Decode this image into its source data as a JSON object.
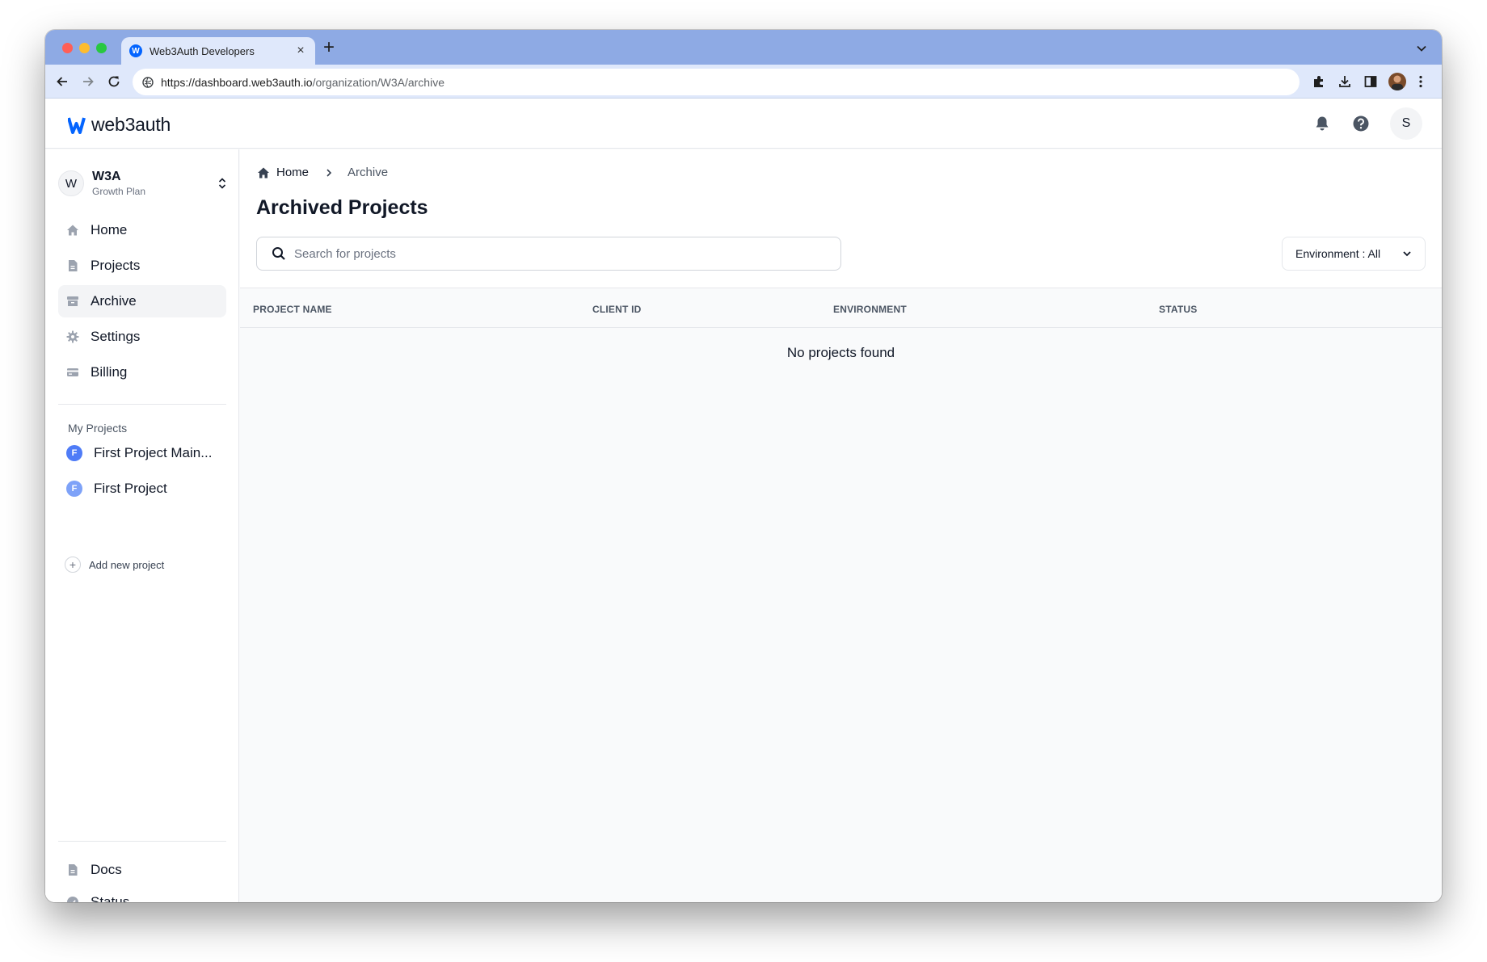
{
  "browser": {
    "tab_title": "Web3Auth Developers",
    "url_host": "https://dashboard.web3auth.io",
    "url_path": "/organization/W3A/archive",
    "tab_favicon_letter": "W"
  },
  "app": {
    "logo_text": "web3auth",
    "brand_color": "#0364ff",
    "user_initial": "S"
  },
  "org": {
    "initial": "W",
    "name": "W3A",
    "plan": "Growth Plan"
  },
  "sidebar": {
    "items": [
      {
        "label": "Home",
        "icon": "home-icon"
      },
      {
        "label": "Projects",
        "icon": "document-icon"
      },
      {
        "label": "Archive",
        "icon": "archive-icon",
        "active": true
      },
      {
        "label": "Settings",
        "icon": "gear-icon"
      },
      {
        "label": "Billing",
        "icon": "credit-card-icon"
      }
    ],
    "projects_title": "My Projects",
    "projects": [
      {
        "badge": "F",
        "label": "First Project Main...",
        "color": "#4f7cf7"
      },
      {
        "badge": "F",
        "label": "First Project",
        "color": "#7ea2f8"
      }
    ],
    "add_project_label": "Add new project",
    "bottom": [
      {
        "label": "Docs",
        "icon": "document-icon"
      },
      {
        "label": "Status",
        "icon": "check-circle-icon"
      }
    ]
  },
  "main": {
    "breadcrumb": {
      "home": "Home",
      "current": "Archive"
    },
    "title": "Archived Projects",
    "search_placeholder": "Search for projects",
    "environment_filter": "Environment : All",
    "columns": [
      "PROJECT NAME",
      "CLIENT ID",
      "ENVIRONMENT",
      "STATUS"
    ],
    "empty_message": "No projects found"
  }
}
